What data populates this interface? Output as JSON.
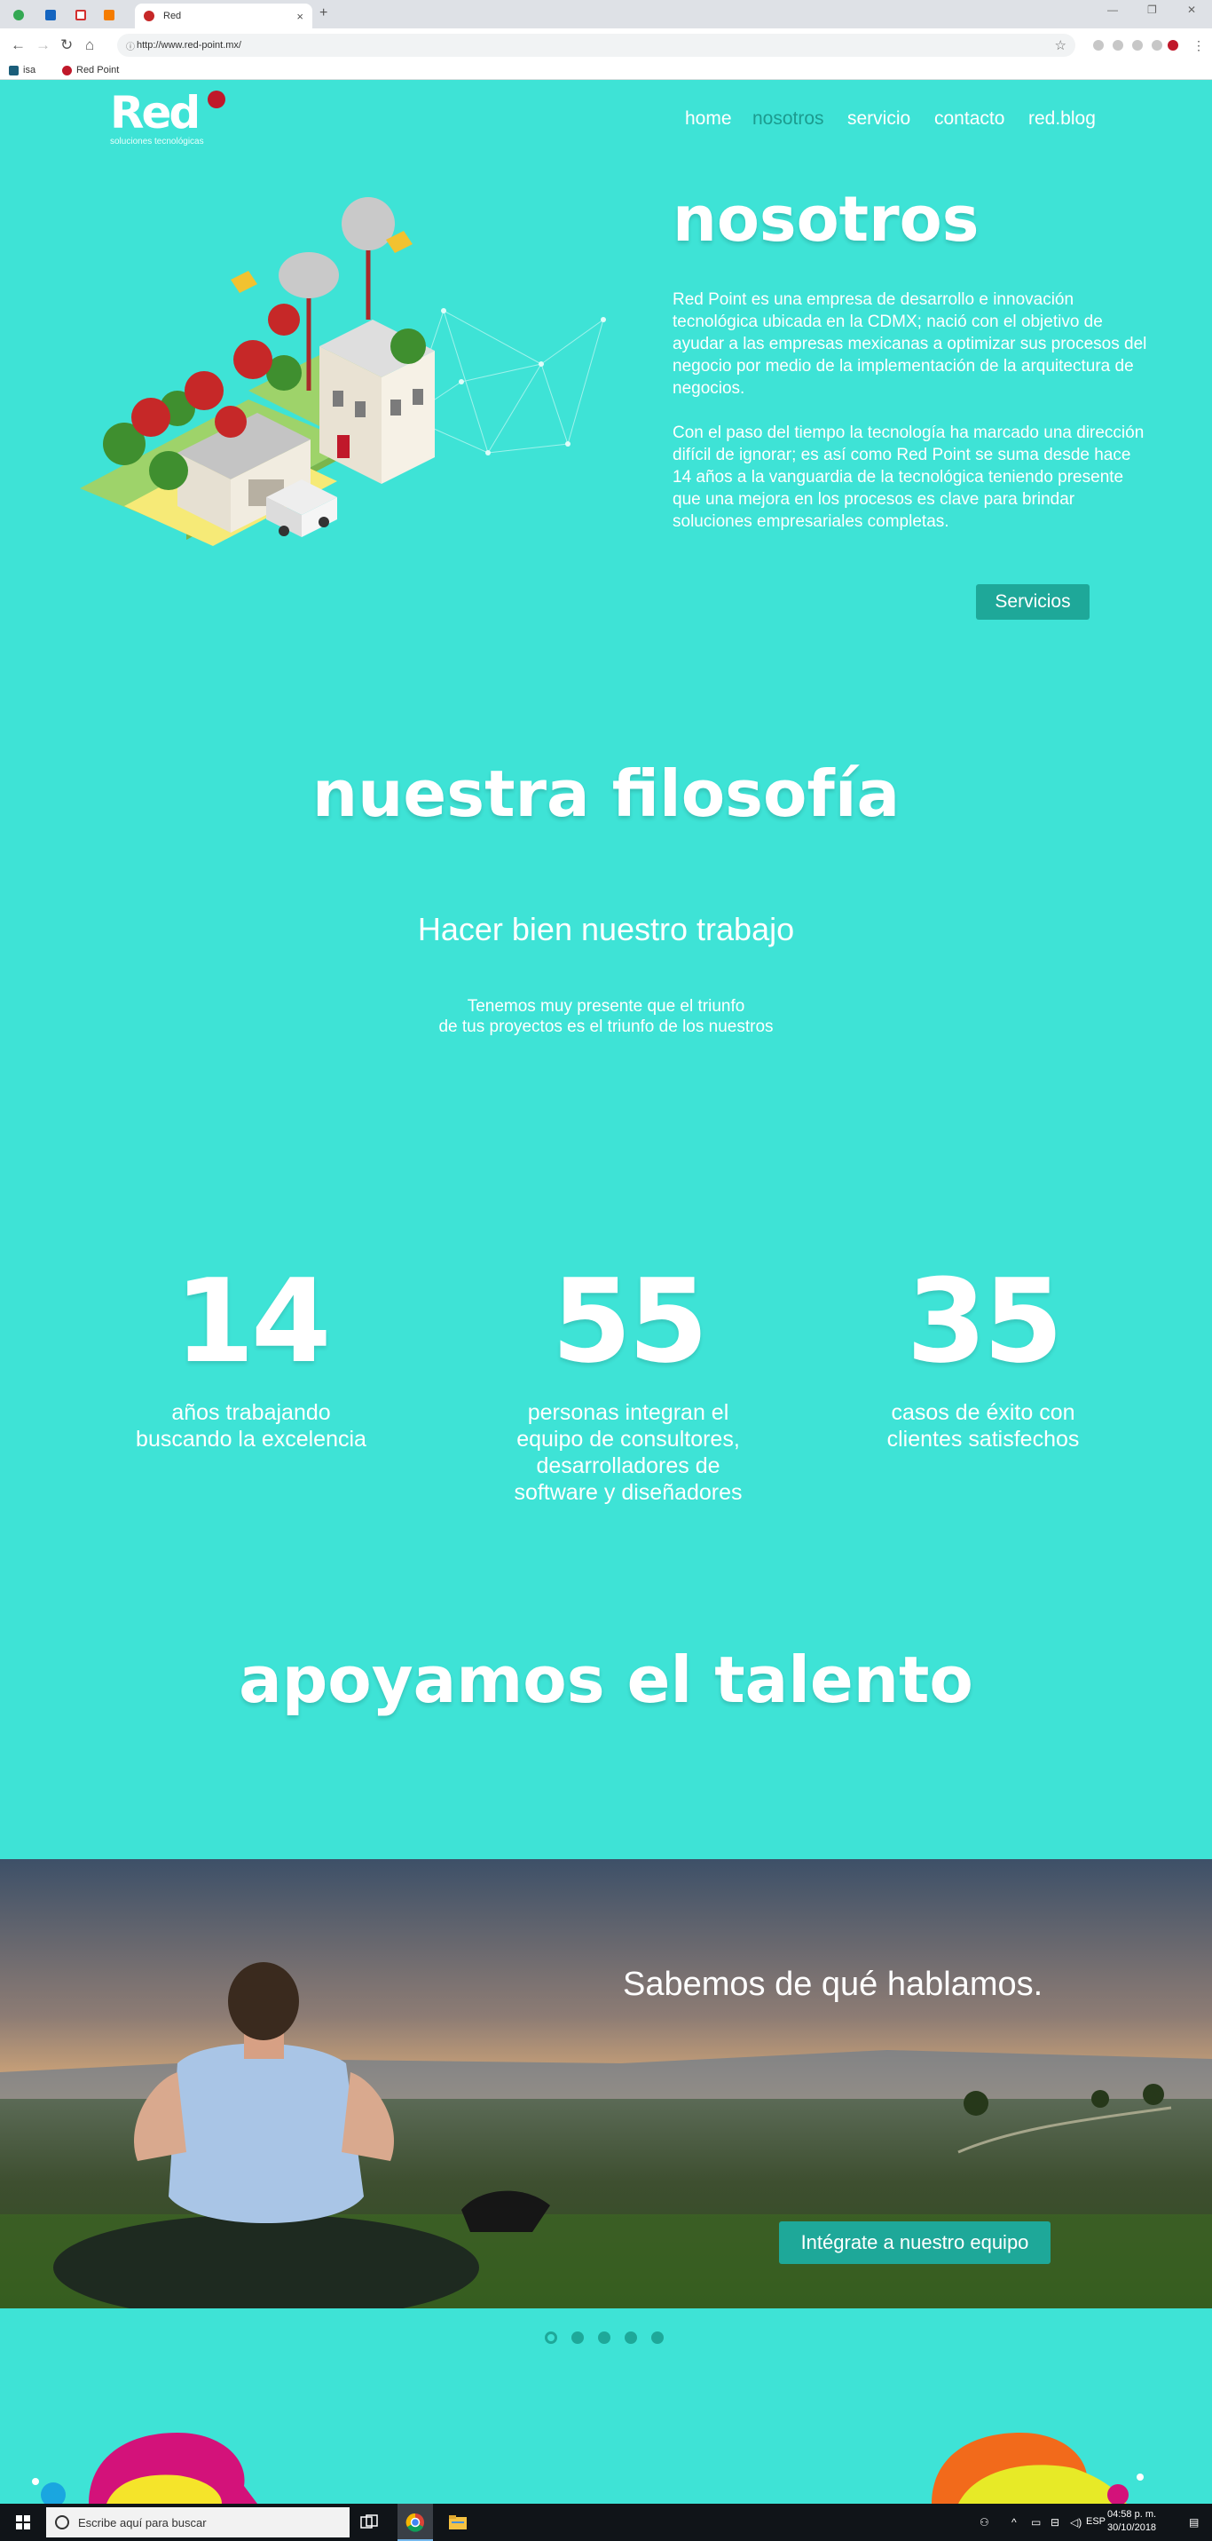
{
  "browser": {
    "tab_title": "Red",
    "url": "http://www.red-point.mx/",
    "bookmarks": [
      "isa",
      "Red Point"
    ]
  },
  "site": {
    "logo_word": "Red",
    "logo_tagline": "soluciones tecnológicas",
    "nav": [
      {
        "label": "home",
        "active": false
      },
      {
        "label": "nosotros",
        "active": true
      },
      {
        "label": "servicio",
        "active": false
      },
      {
        "label": "contacto",
        "active": false
      },
      {
        "label": "red.blog",
        "active": false
      }
    ]
  },
  "nosotros": {
    "title": "nosotros",
    "p1": "Red Point es una empresa de desarrollo e innovación tecnológica ubicada en la CDMX; nació con el objetivo de ayudar a las empresas mexicanas a optimizar sus procesos del negocio por medio de la implementación de la arquitectura de negocios.",
    "p2": "Con el paso del tiempo la tecnología ha marcado una dirección difícil de ignorar; es así como Red Point se suma desde hace 14 años a la vanguardia de la tecnológica teniendo presente que una mejora en los procesos es clave para brindar soluciones empresariales completas.",
    "button": "Servicios"
  },
  "filosofia": {
    "title": "nuestra filosofía",
    "subtitle": "Hacer bien nuestro trabajo",
    "line1": "Tenemos muy presente que el triunfo",
    "line2": "de tus proyectos es el triunfo de los nuestros"
  },
  "stats": [
    {
      "num": "14",
      "lines": [
        "años trabajando",
        "buscando la excelencia"
      ]
    },
    {
      "num": "55",
      "lines": [
        "personas integran el",
        "equipo de  consultores,",
        "desarrolladores de",
        "software y diseñadores"
      ]
    },
    {
      "num": "35",
      "lines": [
        "casos de éxito con",
        "clientes satisfechos"
      ]
    }
  ],
  "talento": {
    "title": "apoyamos el talento",
    "slide_caption": "Sabemos de qué hablamos.",
    "slide_button": "Intégrate a nuestro equipo",
    "slide_count": 5,
    "active_slide": 1
  },
  "taskbar": {
    "search_placeholder": "Escribe aquí para buscar",
    "lang": "ESP",
    "time": "04:58 p. m.",
    "date": "30/10/2018"
  },
  "colors": {
    "background": "#3ee3d6",
    "accent": "#1ea899",
    "logo_dot": "#c0182a"
  }
}
